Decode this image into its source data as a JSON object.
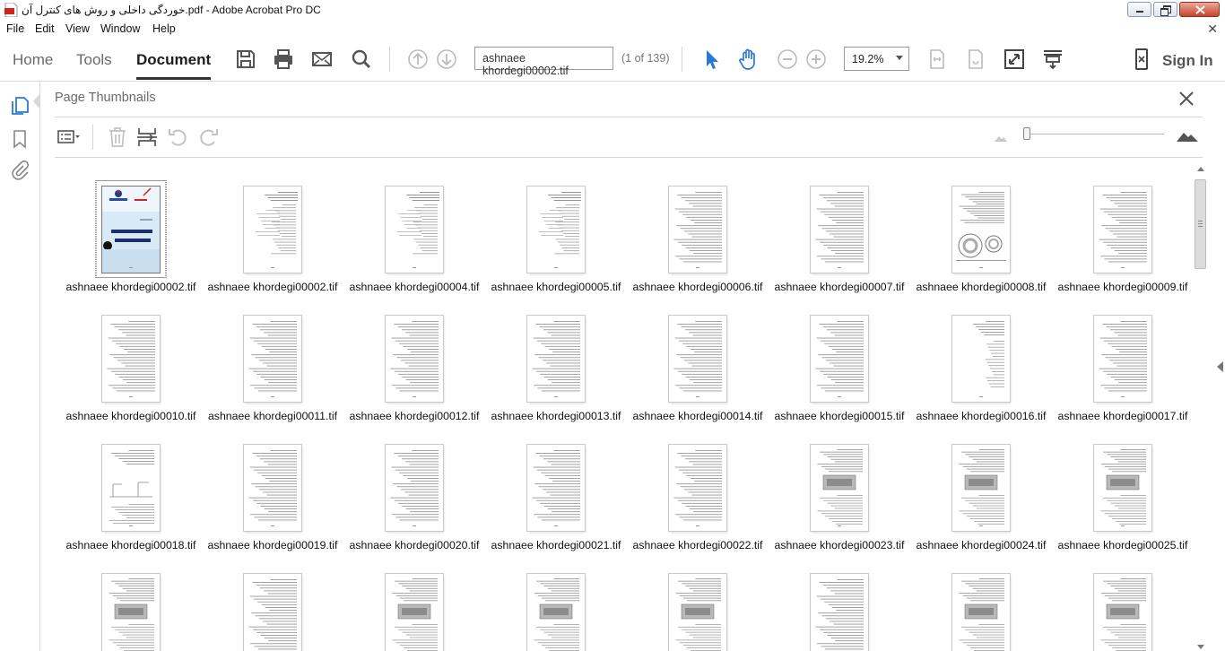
{
  "window": {
    "title": "خوردگی داخلی و روش های کنترل آن.pdf - Adobe Acrobat Pro DC"
  },
  "menu": {
    "items": [
      "File",
      "Edit",
      "View",
      "Window",
      "Help"
    ]
  },
  "toolbar": {
    "tabs": [
      "Home",
      "Tools",
      "Document"
    ],
    "active_tab": "Document",
    "page_field_value": "ashnaee khordegi00002.tif",
    "page_of": "(1 of 139)",
    "zoom_value": "19.2%",
    "sign_in_label": "Sign In",
    "accent": "#2b79d6"
  },
  "panel": {
    "title": "Page Thumbnails"
  },
  "thumbnails": [
    {
      "label": "ashnaee khordegi00002.tif",
      "kind": "cover",
      "selected": true
    },
    {
      "label": "ashnaee khordegi00002.tif",
      "kind": "toc"
    },
    {
      "label": "ashnaee khordegi00004.tif",
      "kind": "toc"
    },
    {
      "label": "ashnaee khordegi00005.tif",
      "kind": "toc"
    },
    {
      "label": "ashnaee khordegi00006.tif",
      "kind": "text"
    },
    {
      "label": "ashnaee khordegi00007.tif",
      "kind": "text"
    },
    {
      "label": "ashnaee khordegi00008.tif",
      "kind": "figure-circles"
    },
    {
      "label": "ashnaee khordegi00009.tif",
      "kind": "text"
    },
    {
      "label": "ashnaee khordegi00010.tif",
      "kind": "text"
    },
    {
      "label": "ashnaee khordegi00011.tif",
      "kind": "text"
    },
    {
      "label": "ashnaee khordegi00012.tif",
      "kind": "text"
    },
    {
      "label": "ashnaee khordegi00013.tif",
      "kind": "text"
    },
    {
      "label": "ashnaee khordegi00014.tif",
      "kind": "text"
    },
    {
      "label": "ashnaee khordegi00015.tif",
      "kind": "text"
    },
    {
      "label": "ashnaee khordegi00016.tif",
      "kind": "list"
    },
    {
      "label": "ashnaee khordegi00017.tif",
      "kind": "text"
    },
    {
      "label": "ashnaee khordegi00018.tif",
      "kind": "figure-small"
    },
    {
      "label": "ashnaee khordegi00019.tif",
      "kind": "text"
    },
    {
      "label": "ashnaee khordegi00020.tif",
      "kind": "text"
    },
    {
      "label": "ashnaee khordegi00021.tif",
      "kind": "text"
    },
    {
      "label": "ashnaee khordegi00022.tif",
      "kind": "text"
    },
    {
      "label": "ashnaee khordegi00023.tif",
      "kind": "figure-box"
    },
    {
      "label": "ashnaee khordegi00024.tif",
      "kind": "figure-box"
    },
    {
      "label": "ashnaee khordegi00025.tif",
      "kind": "figure-box"
    },
    {
      "label": "",
      "kind": "figure-box"
    },
    {
      "label": "",
      "kind": "text"
    },
    {
      "label": "",
      "kind": "figure-box"
    },
    {
      "label": "",
      "kind": "figure-box"
    },
    {
      "label": "",
      "kind": "figure-box"
    },
    {
      "label": "",
      "kind": "text"
    },
    {
      "label": "",
      "kind": "figure-box"
    },
    {
      "label": "",
      "kind": "figure-box"
    }
  ]
}
